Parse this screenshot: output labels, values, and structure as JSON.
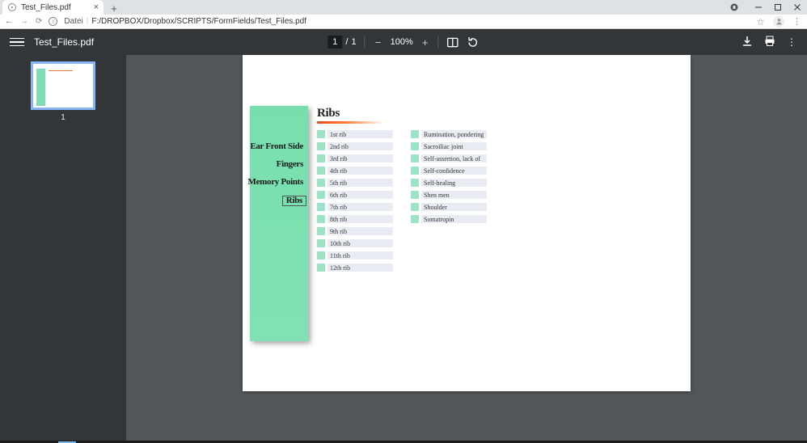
{
  "browser": {
    "tab_title": "Test_Files.pdf",
    "url_scheme": "Datei",
    "url_path": "F:/DROPBOX/Dropbox/SCRIPTS/FormFields/Test_Files.pdf"
  },
  "pdf_toolbar": {
    "filename": "Test_Files.pdf",
    "page_current": "1",
    "page_sep": "/",
    "page_total": "1",
    "zoom": "100%"
  },
  "thumbnail": {
    "number": "1"
  },
  "doc": {
    "heading": "Ribs",
    "nav_items": [
      "Ear Front Side",
      "Fingers",
      "Memory Points",
      "Ribs"
    ],
    "nav_selected_index": 3,
    "column1": [
      "1st rib",
      "2nd rib",
      "3rd rib",
      "4th rib",
      "5th rib",
      "6th rib",
      "7th rib",
      "8th rib",
      "9th rib",
      "10th rib",
      "11th rib",
      "12th rib"
    ],
    "column2": [
      "Rumination, pondering",
      "Sacroiliac joint",
      "Self-assertion, lack of",
      "Self-confidence",
      "Self-healing",
      "Shen men",
      "Shoulder",
      "Somatropin"
    ]
  }
}
